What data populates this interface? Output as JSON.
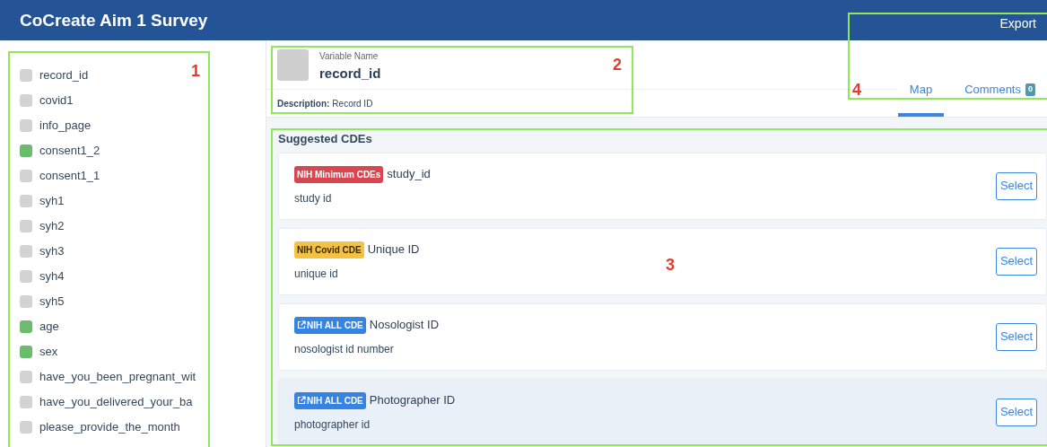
{
  "header": {
    "title": "CoCreate Aim 1 Survey",
    "export": "Export"
  },
  "sidebar": {
    "items": [
      {
        "label": "record_id",
        "mapped": false
      },
      {
        "label": "covid1",
        "mapped": false
      },
      {
        "label": "info_page",
        "mapped": false
      },
      {
        "label": "consent1_2",
        "mapped": true
      },
      {
        "label": "consent1_1",
        "mapped": false
      },
      {
        "label": "syh1",
        "mapped": false
      },
      {
        "label": "syh2",
        "mapped": false
      },
      {
        "label": "syh3",
        "mapped": false
      },
      {
        "label": "syh4",
        "mapped": false
      },
      {
        "label": "syh5",
        "mapped": false
      },
      {
        "label": "age",
        "mapped": true
      },
      {
        "label": "sex",
        "mapped": true
      },
      {
        "label": "have_you_been_pregnant_wit",
        "mapped": false
      },
      {
        "label": "have_you_delivered_your_ba",
        "mapped": false
      },
      {
        "label": "please_provide_the_month",
        "mapped": false
      }
    ]
  },
  "variable": {
    "caption": "Variable Name",
    "name": "record_id",
    "description_label": "Description:",
    "description": "Record ID"
  },
  "tabs": [
    {
      "label": "Map",
      "selected": true
    },
    {
      "label": "Comments",
      "count": "0",
      "selected": false
    }
  ],
  "suggested": {
    "title": "Suggested CDEs",
    "cards": [
      {
        "badge": {
          "kind": "danger",
          "text": "NIH Minimum CDEs"
        },
        "name": "study_id",
        "description": "study id",
        "button": "Select",
        "highlighted": false
      },
      {
        "badge": {
          "kind": "warning",
          "text": "NIH Covid CDE"
        },
        "name": "Unique ID",
        "description": "unique id",
        "button": "Select",
        "highlighted": false
      },
      {
        "badge": {
          "kind": "link",
          "text": "NIH ALL CDE"
        },
        "name": "Nosologist ID",
        "description": "nosologist id number",
        "button": "Select",
        "highlighted": false
      },
      {
        "badge": {
          "kind": "link",
          "text": "NIH ALL CDE"
        },
        "name": "Photographer ID",
        "description": "photographer id",
        "button": "Select",
        "highlighted": true
      }
    ]
  },
  "annotations": [
    {
      "label": "1"
    },
    {
      "label": "2"
    },
    {
      "label": "3"
    },
    {
      "label": "4"
    }
  ]
}
